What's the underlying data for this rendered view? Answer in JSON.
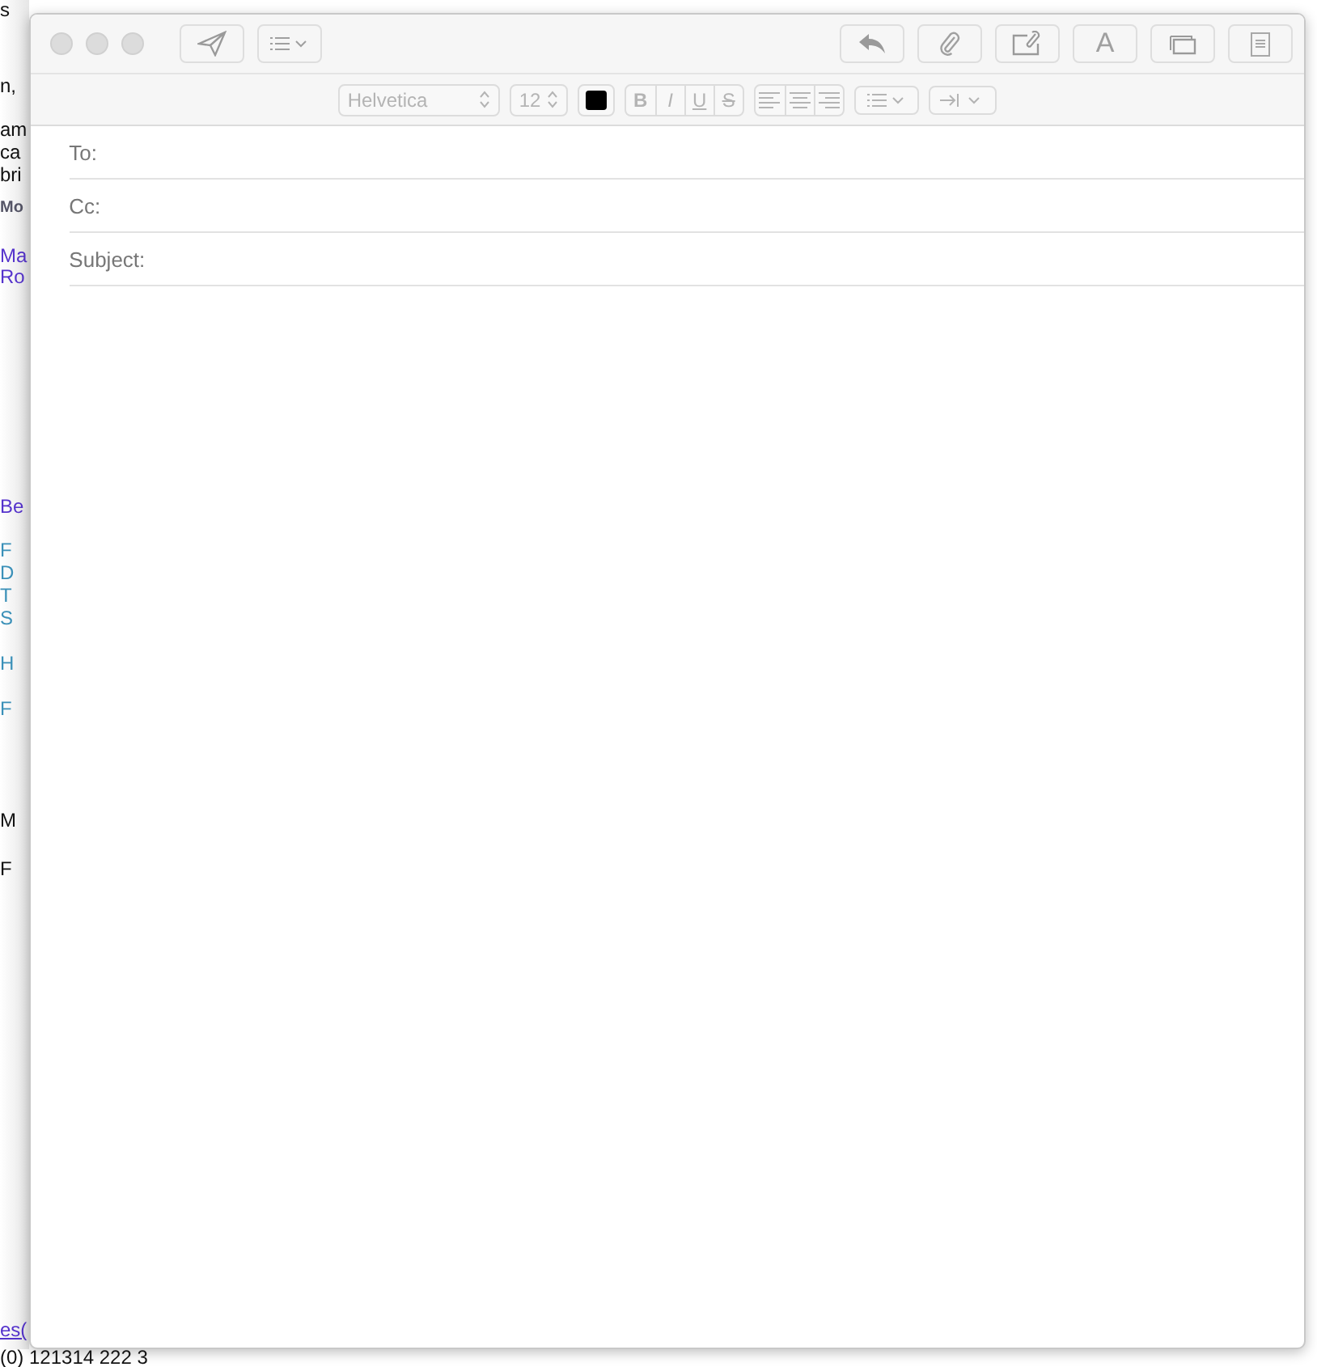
{
  "background_document": {
    "fragments": [
      {
        "text": "s",
        "kind": "text"
      },
      {
        "text": "n,",
        "kind": "text"
      },
      {
        "text": "am",
        "kind": "text"
      },
      {
        "text": "ca",
        "kind": "text"
      },
      {
        "text": "bri",
        "kind": "text"
      },
      {
        "text": "Mo",
        "kind": "caption"
      },
      {
        "text": "Ma",
        "kind": "link"
      },
      {
        "text": "Ro",
        "kind": "link"
      },
      {
        "text": "Be",
        "kind": "link"
      },
      {
        "text": "F",
        "kind": "accent"
      },
      {
        "text": "D",
        "kind": "accent"
      },
      {
        "text": "T",
        "kind": "accent"
      },
      {
        "text": "S",
        "kind": "accent"
      },
      {
        "text": "H",
        "kind": "accent"
      },
      {
        "text": "F",
        "kind": "accent"
      },
      {
        "text": "M",
        "kind": "text"
      },
      {
        "text": "F",
        "kind": "text"
      },
      {
        "text": "es(",
        "kind": "link"
      }
    ],
    "footer_line": "(0) 121314 222 3"
  },
  "compose_window": {
    "toolbar": {
      "left": [
        {
          "kind": "send"
        },
        {
          "kind": "list-menu"
        }
      ],
      "right": [
        {
          "kind": "reply"
        },
        {
          "kind": "attach"
        },
        {
          "kind": "markup"
        },
        {
          "kind": "fonts",
          "label": "A"
        },
        {
          "kind": "windows"
        },
        {
          "kind": "note"
        }
      ]
    },
    "format_bar": {
      "disabled": true,
      "font": "Helvetica",
      "size": "12",
      "color": "#000000",
      "styles": [
        {
          "label": "B",
          "kind": "bold"
        },
        {
          "label": "I",
          "kind": "italic"
        },
        {
          "label": "U",
          "kind": "underline"
        },
        {
          "label": "S",
          "kind": "strike"
        }
      ]
    },
    "fields": [
      {
        "label": "To:"
      },
      {
        "label": "Cc:"
      },
      {
        "label": "Subject:"
      }
    ]
  }
}
